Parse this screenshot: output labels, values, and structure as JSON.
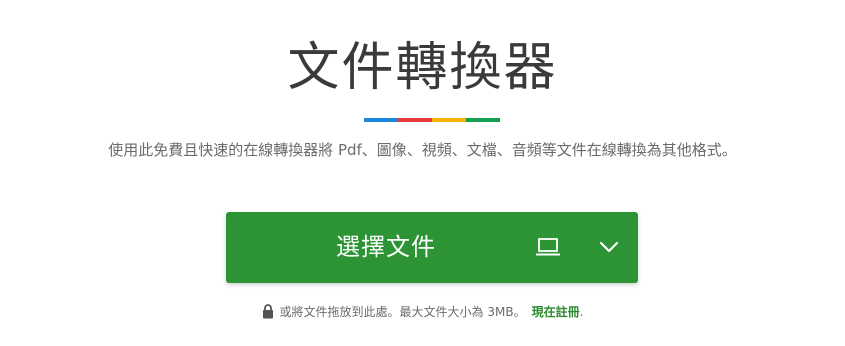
{
  "header": {
    "title": "文件轉換器",
    "subtitle": "使用此免費且快速的在線轉換器將 Pdf、圖像、視頻、文檔、音頻等文件在線轉換為其他格式。"
  },
  "accent_bar_colors": [
    "#1a86e0",
    "#e53a3a",
    "#f4b400",
    "#10a050"
  ],
  "upload": {
    "choose_label": "選擇文件",
    "device_icon": "computer-icon",
    "dropdown_icon": "chevron-down-icon",
    "button_color": "#2c9434"
  },
  "note": {
    "text": "或將文件拖放到此處。最大文件大小為 3MB。",
    "link_text": "現在註冊",
    "suffix": ".",
    "link_color": "#2c8a2f"
  }
}
